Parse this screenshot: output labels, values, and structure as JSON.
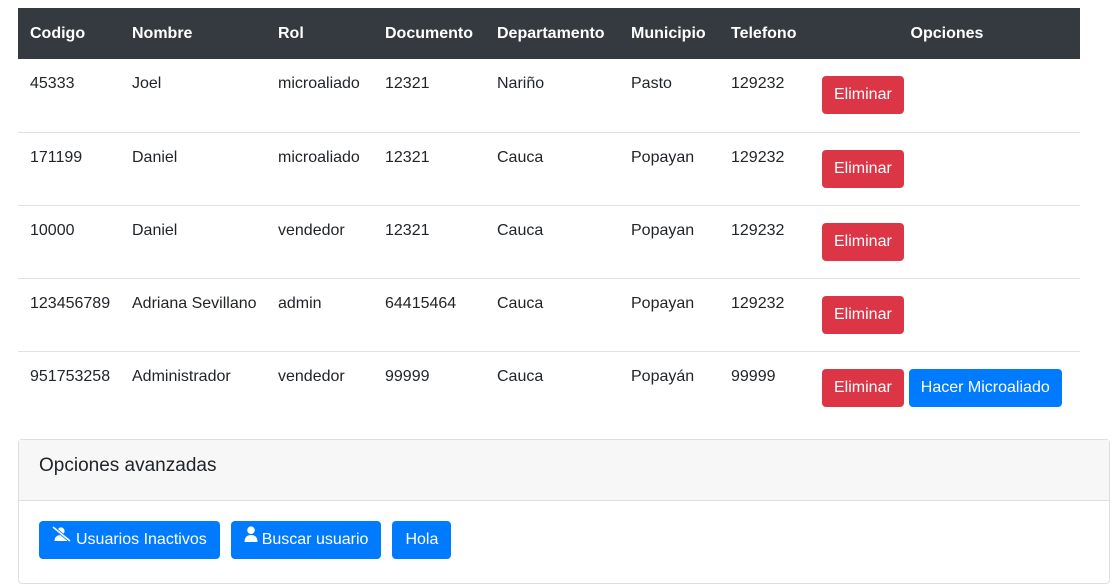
{
  "table": {
    "headers": [
      "Codigo",
      "Nombre",
      "Rol",
      "Documento",
      "Departamento",
      "Municipio",
      "Telefono",
      "Opciones"
    ],
    "rows": [
      {
        "codigo": "45333",
        "nombre": "Joel",
        "rol": "microaliado",
        "documento": "12321",
        "departamento": "Nariño",
        "municipio": "Pasto",
        "telefono": "129232",
        "actions": [
          "Eliminar"
        ]
      },
      {
        "codigo": "171199",
        "nombre": "Daniel",
        "rol": "microaliado",
        "documento": "12321",
        "departamento": "Cauca",
        "municipio": "Popayan",
        "telefono": "129232",
        "actions": [
          "Eliminar"
        ]
      },
      {
        "codigo": "10000",
        "nombre": "Daniel",
        "rol": "vendedor",
        "documento": "12321",
        "departamento": "Cauca",
        "municipio": "Popayan",
        "telefono": "129232",
        "actions": [
          "Eliminar"
        ]
      },
      {
        "codigo": "123456789",
        "nombre": "Adriana Sevillano",
        "rol": "admin",
        "documento": "64415464",
        "departamento": "Cauca",
        "municipio": "Popayan",
        "telefono": "129232",
        "actions": [
          "Eliminar"
        ]
      },
      {
        "codigo": "951753258",
        "nombre": "Administrador",
        "rol": "vendedor",
        "documento": "99999",
        "departamento": "Cauca",
        "municipio": "Popayán",
        "telefono": "99999",
        "actions": [
          "Eliminar",
          "Hacer Microaliado"
        ]
      }
    ]
  },
  "advanced": {
    "title": "Opciones avanzadas",
    "buttons": [
      {
        "label": "Usuarios Inactivos",
        "icon": "user-slash-icon"
      },
      {
        "label": "Buscar usuario",
        "icon": "user-icon"
      },
      {
        "label": "Hola",
        "icon": ""
      }
    ]
  },
  "colors": {
    "header_bg": "#343a40",
    "danger": "#dc3545",
    "primary": "#007bff"
  }
}
